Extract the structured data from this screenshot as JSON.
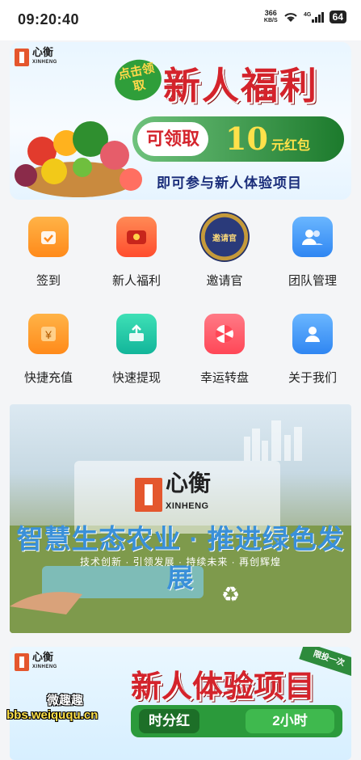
{
  "status_bar": {
    "time": "09:20:40",
    "net_speed": "366",
    "net_unit": "KB/S",
    "signal": "4G",
    "battery": "64"
  },
  "banner_new_user": {
    "logo_text": "心衡",
    "logo_sub": "XINHENG",
    "click_tag": "点击领取",
    "title": "新人福利",
    "can_claim": "可领取",
    "amount": "10",
    "amount_unit": "元红包",
    "subtitle": "即可参与新人体验项目"
  },
  "menu": [
    {
      "label": "签到",
      "icon": "calendar-check-icon"
    },
    {
      "label": "新人福利",
      "icon": "red-packet-icon"
    },
    {
      "label": "邀请官",
      "icon": "inviter-badge-icon",
      "badge_text": "邀请官"
    },
    {
      "label": "团队管理",
      "icon": "team-icon"
    },
    {
      "label": "快捷充值",
      "icon": "yen-icon"
    },
    {
      "label": "快速提现",
      "icon": "withdraw-icon"
    },
    {
      "label": "幸运转盘",
      "icon": "wheel-icon"
    },
    {
      "label": "关于我们",
      "icon": "people-icon"
    }
  ],
  "banner_agri": {
    "logo_text": "心衡",
    "logo_sub": "XINHENG",
    "slogan": "智慧生态农业 · 推进绿色发展",
    "sub": "技术创新 · 引领发展 · 持续未来 · 再创辉煌"
  },
  "banner_experience": {
    "logo_text": "心衡",
    "logo_sub": "XINHENG",
    "title": "新人体验项目",
    "ribbon": "限投一次",
    "left_chip": "时分红",
    "right_chip": "2小时"
  },
  "watermark": {
    "line1": "微趣趣",
    "line2": "bbs.weiququ.cn"
  }
}
